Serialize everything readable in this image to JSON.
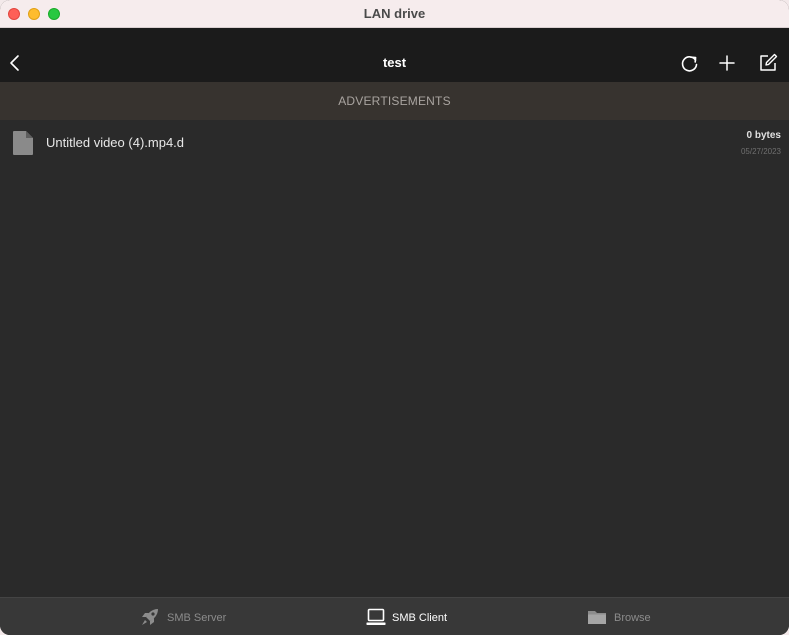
{
  "window": {
    "title": "LAN drive"
  },
  "navbar": {
    "title": "test",
    "icons": [
      "chevron-left-icon",
      "refresh-icon",
      "plus-icon",
      "compose-icon"
    ]
  },
  "ad_banner": {
    "label": "ADVERTISEMENTS"
  },
  "files": [
    {
      "name": "Untitled video (4).mp4.d",
      "size": "0 bytes",
      "date": "05/27/2023",
      "icon": "document-icon"
    }
  ],
  "tabs": [
    {
      "label": "SMB Server",
      "icon": "rocket-icon",
      "active": false
    },
    {
      "label": "SMB Client",
      "icon": "laptop-icon",
      "active": true
    },
    {
      "label": "Browse",
      "icon": "folder-icon",
      "active": false
    }
  ],
  "colors": {
    "navbar_bg": "#1b1b1b",
    "content_bg": "#2a2a2a",
    "adbar_bg": "#37332f",
    "tabbar_bg": "#383838",
    "active_tab": "#ffffff",
    "inactive_tab": "#8c8c8c"
  }
}
